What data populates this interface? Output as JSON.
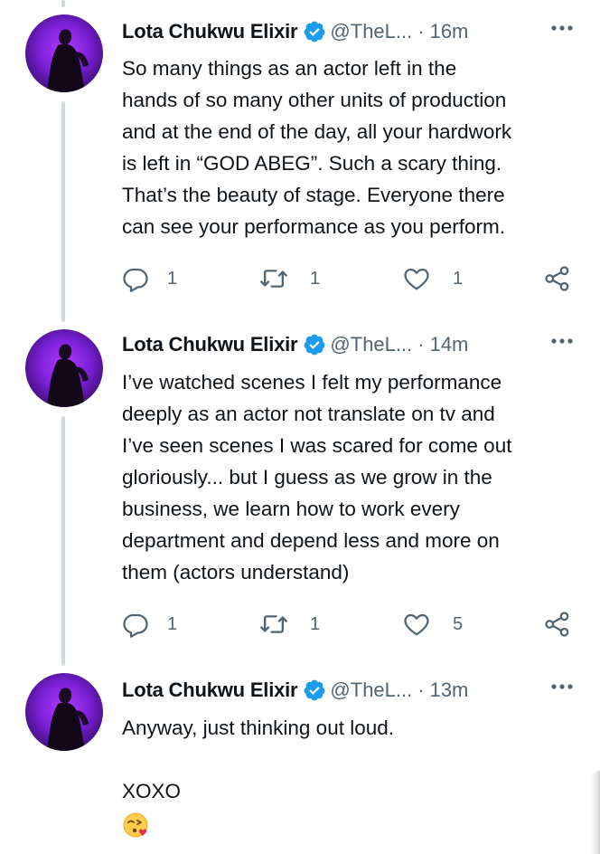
{
  "tweets": [
    {
      "author": "Lota Chukwu Elixir",
      "handle": "@TheL...",
      "separator": "·",
      "time": "16m",
      "lines": [
        "So many things as an actor left in the",
        "hands of so many other units of production",
        "and at the end of the day, all your hardwork",
        "is left in “GOD ABEG”. Such a scary thing.",
        "That’s the beauty of stage. Everyone there",
        "can see your performance as you perform."
      ],
      "replies": "1",
      "retweets": "1",
      "likes": "1"
    },
    {
      "author": "Lota Chukwu Elixir",
      "handle": "@TheL...",
      "separator": "·",
      "time": "14m",
      "lines": [
        "I’ve watched scenes I felt my performance",
        "deeply as an actor not translate on tv and",
        "I’ve seen scenes I was scared for come out",
        "gloriously... but I guess as we grow in the",
        "business, we learn how to work every",
        "department and depend less and more on",
        "them (actors understand)"
      ],
      "replies": "1",
      "retweets": "1",
      "likes": "5"
    },
    {
      "author": "Lota Chukwu Elixir",
      "handle": "@TheL...",
      "separator": "·",
      "time": "13m",
      "lines": [
        "Anyway, just thinking out loud.",
        "",
        "XOXO"
      ],
      "emoji": "face-blowing-a-kiss"
    }
  ],
  "colors": {
    "text": "#0f1419",
    "secondary": "#536471",
    "verified": "#1d9bf0",
    "thread_line": "#cfd9de"
  }
}
